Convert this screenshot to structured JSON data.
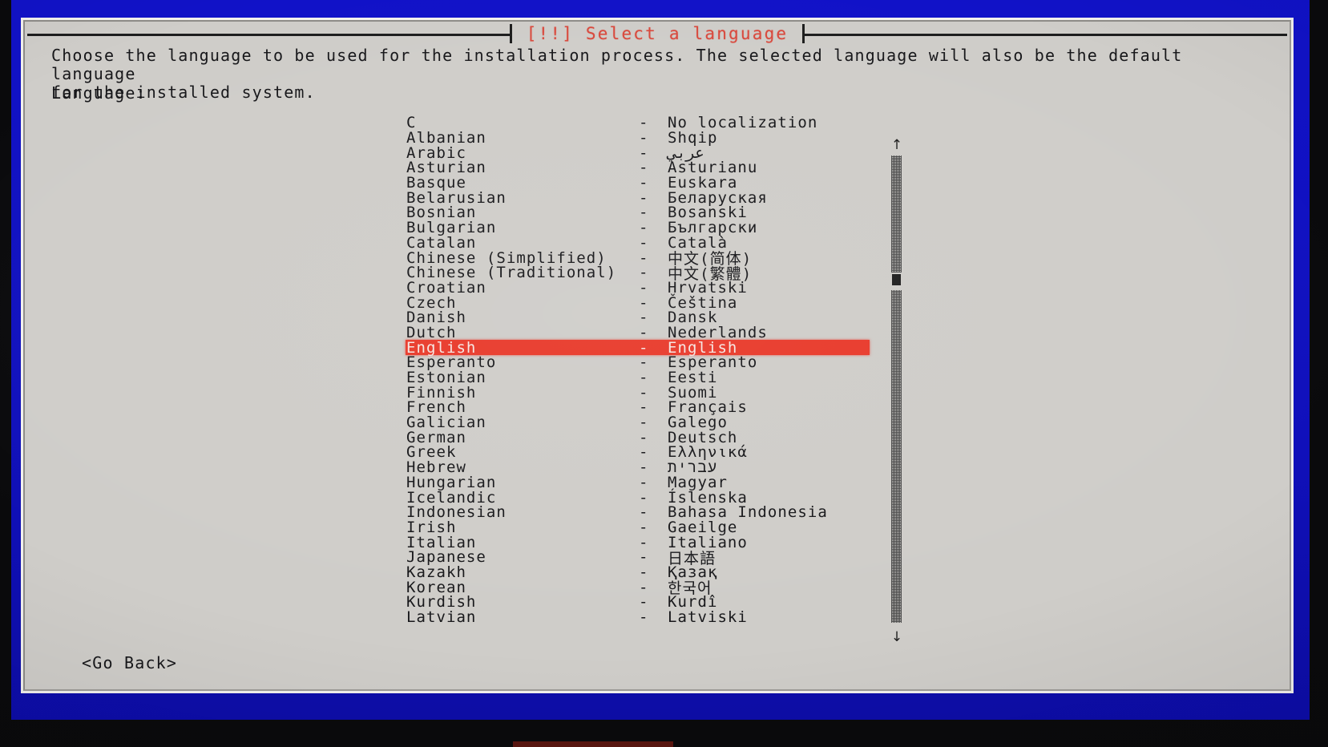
{
  "dialog": {
    "title": "[!!] Select a language",
    "title_color": "#d9483c",
    "intro_text": "Choose the language to be used for the installation process. The selected language will also be the default language\nfor the installed system.",
    "field_label": "Language:",
    "background_color": "#cfcdc9",
    "selection_color": "#e8392a"
  },
  "console": {
    "background_color": "#1112c8"
  },
  "language_list": {
    "separator": "-",
    "selected_index": 15,
    "items": [
      {
        "name": "C",
        "native": "No localization"
      },
      {
        "name": "Albanian",
        "native": "Shqip"
      },
      {
        "name": "Arabic",
        "native": "عربي"
      },
      {
        "name": "Asturian",
        "native": "Asturianu"
      },
      {
        "name": "Basque",
        "native": "Euskara"
      },
      {
        "name": "Belarusian",
        "native": "Беларуская"
      },
      {
        "name": "Bosnian",
        "native": "Bosanski"
      },
      {
        "name": "Bulgarian",
        "native": "Български"
      },
      {
        "name": "Catalan",
        "native": "Català"
      },
      {
        "name": "Chinese (Simplified)",
        "native": "中文(简体)"
      },
      {
        "name": "Chinese (Traditional)",
        "native": "中文(繁體)"
      },
      {
        "name": "Croatian",
        "native": "Hrvatski"
      },
      {
        "name": "Czech",
        "native": "Čeština"
      },
      {
        "name": "Danish",
        "native": "Dansk"
      },
      {
        "name": "Dutch",
        "native": "Nederlands"
      },
      {
        "name": "English",
        "native": "English"
      },
      {
        "name": "Esperanto",
        "native": "Esperanto"
      },
      {
        "name": "Estonian",
        "native": "Eesti"
      },
      {
        "name": "Finnish",
        "native": "Suomi"
      },
      {
        "name": "French",
        "native": "Français"
      },
      {
        "name": "Galician",
        "native": "Galego"
      },
      {
        "name": "German",
        "native": "Deutsch"
      },
      {
        "name": "Greek",
        "native": "Ελληνικά"
      },
      {
        "name": "Hebrew",
        "native": "עברית"
      },
      {
        "name": "Hungarian",
        "native": "Magyar"
      },
      {
        "name": "Icelandic",
        "native": "Íslenska"
      },
      {
        "name": "Indonesian",
        "native": "Bahasa Indonesia"
      },
      {
        "name": "Irish",
        "native": "Gaeilge"
      },
      {
        "name": "Italian",
        "native": "Italiano"
      },
      {
        "name": "Japanese",
        "native": "日本語"
      },
      {
        "name": "Kazakh",
        "native": "Қазақ"
      },
      {
        "name": "Korean",
        "native": "한국어"
      },
      {
        "name": "Kurdish",
        "native": "Kurdî"
      },
      {
        "name": "Latvian",
        "native": "Latviski"
      }
    ]
  },
  "scrollbar": {
    "up_arrow": "↑",
    "down_arrow": "↓"
  },
  "buttons": {
    "go_back": "<Go Back>"
  }
}
